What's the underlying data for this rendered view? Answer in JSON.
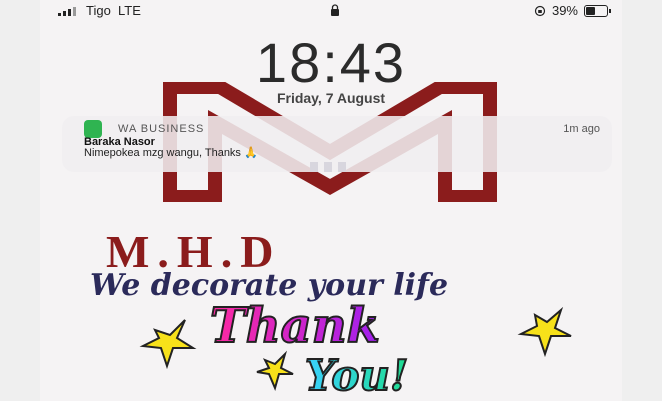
{
  "status_bar": {
    "carrier": "Tigo",
    "network": "LTE",
    "battery_percent": "39%",
    "battery_level": 0.39
  },
  "lock_screen": {
    "time": "18:43",
    "date": "Friday, 7 August"
  },
  "notification": {
    "app": "WA BUSINESS",
    "time": "1m ago",
    "title": "Baraka Nasor",
    "body": "Nimepokea mzg wangu, Thanks 🙏"
  },
  "wallpaper": {
    "brand": "M.H.D",
    "tagline": "We decorate your life",
    "art_text": "Thank You!"
  },
  "colors": {
    "brand_red": "#8b1c1c",
    "tagline_navy": "#2b2a5a",
    "whatsapp_green": "#2fb451"
  }
}
